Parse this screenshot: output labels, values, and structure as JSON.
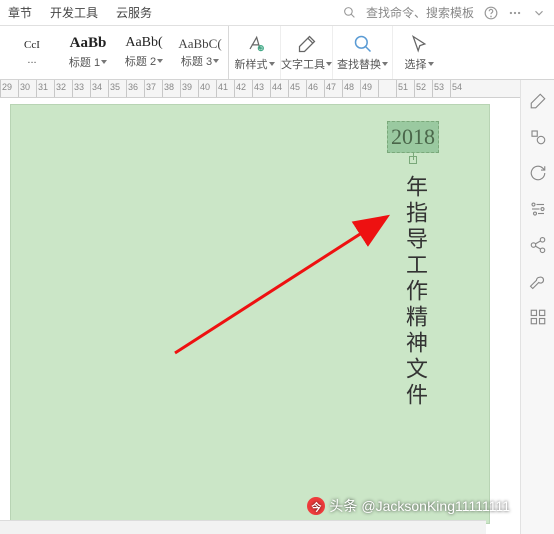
{
  "menu": {
    "chapter": "章节",
    "devtools": "开发工具",
    "cloud": "云服务",
    "searchHint": "查找命令、搜索模板"
  },
  "styles": {
    "item1": {
      "preview": "CcI",
      "label": "..."
    },
    "item2": {
      "preview": "AaBb",
      "label": "标题 1"
    },
    "item3": {
      "preview": "AaBb(",
      "label": "标题 2"
    },
    "item4": {
      "preview": "AaBbC(",
      "label": "标题 3"
    }
  },
  "tools": {
    "newStyle": "新样式",
    "textTool": "文字工具",
    "findReplace": "查找替换",
    "select": "选择"
  },
  "ruler": [
    "29",
    "30",
    "31",
    "32",
    "33",
    "34",
    "35",
    "36",
    "37",
    "38",
    "39",
    "40",
    "41",
    "42",
    "43",
    "44",
    "45",
    "46",
    "47",
    "48",
    "49",
    "",
    "51",
    "52",
    "53",
    "54"
  ],
  "document": {
    "year": "2018",
    "title": "年指导工作精神文件"
  },
  "watermark": {
    "prefix": "头条",
    "handle": "@JacksonKing11111111"
  }
}
